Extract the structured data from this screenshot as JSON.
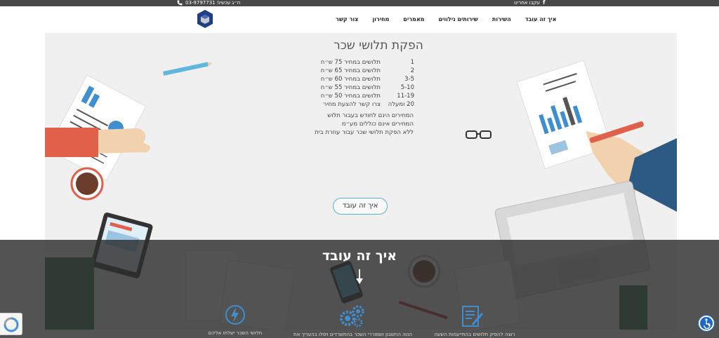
{
  "topbar": {
    "phone": "ח״ג עכשיו! 03-9797731",
    "social": "עקבו אחרינו"
  },
  "nav": {
    "items": [
      {
        "label": "איך זה עובד"
      },
      {
        "label": "השירות"
      },
      {
        "label": "שירותים נילווים"
      },
      {
        "label": "מאמרים"
      },
      {
        "label": "מחירון"
      },
      {
        "label": "צור קשר"
      }
    ]
  },
  "hero": {
    "title": "הפקת תלושי שכר",
    "prices": [
      {
        "qty": "1",
        "price": "תלושים במחיר 75 ש״ח"
      },
      {
        "qty": "2",
        "price": "תלושים במחיר 65 ש״ח"
      },
      {
        "qty": "3-5",
        "price": "תלושים במחיר 60 ש״ח"
      },
      {
        "qty": "5-10",
        "price": "תלושים במחיר 55 ש״ח"
      },
      {
        "qty": "11-19",
        "price": "תלושים במחיר 50 ש״ח"
      },
      {
        "qty": "20 ומעלה",
        "price": "צרו קשר להצעת מחיר"
      }
    ],
    "notes": [
      "המחירים הינם לחודש בעבור תלוש",
      "המחירים אינם כוללים מע״מ",
      "ללא הפקת תלושי שכר עבור עוזרת בית"
    ],
    "button": "איך זה עובד"
  },
  "overlay": {
    "title": "איך זה עובד",
    "steps": [
      {
        "label": "תלושי השכר ישלחו אליכם"
      },
      {
        "label": "הנוה החשבון ושמוררי השכר בהתשרדים ויפלו בהעריך את"
      },
      {
        "label": "רוצה להפיק תלושים בהתייעמות השעה"
      }
    ]
  },
  "colors": {
    "accent": "#3e8ed0",
    "topbar": "#474747",
    "overlay": "#2d2d2d"
  }
}
